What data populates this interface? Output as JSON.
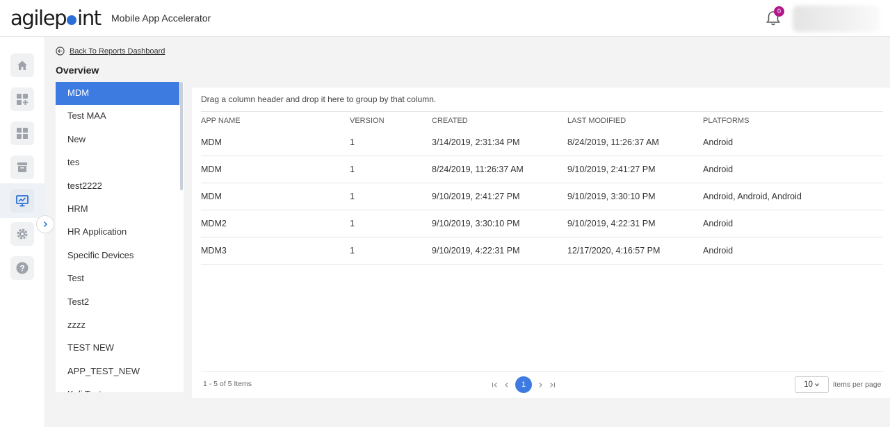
{
  "header": {
    "logo_left": "agilep",
    "logo_right": "int",
    "app_title": "Mobile App Accelerator",
    "notification_count": "0"
  },
  "rail": {
    "items": [
      "home-icon",
      "add-dashboard-icon",
      "dashboard-icon",
      "archive-icon",
      "reports-icon",
      "settings-icon",
      "help-icon"
    ],
    "active": "reports-icon"
  },
  "content": {
    "back_label": "Back To Reports Dashboard",
    "page_title": "Overview"
  },
  "app_list": {
    "items": [
      "MDM",
      "Test MAA",
      "New",
      "tes",
      "test2222",
      "HRM",
      "HR Application",
      "Specific Devices",
      "Test",
      "Test2",
      "zzzz",
      "TEST NEW",
      "APP_TEST_NEW",
      "Kali Test"
    ],
    "selected": "MDM"
  },
  "grid": {
    "group_hint": "Drag a column header and drop it here to group by that column.",
    "columns": [
      "APP NAME",
      "VERSION",
      "CREATED",
      "LAST MODIFIED",
      "PLATFORMS"
    ],
    "rows": [
      [
        "MDM",
        "1",
        "3/14/2019, 2:31:34 PM",
        "8/24/2019, 11:26:37 AM",
        "Android"
      ],
      [
        "MDM",
        "1",
        "8/24/2019, 11:26:37 AM",
        "9/10/2019, 2:41:27 PM",
        "Android"
      ],
      [
        "MDM",
        "1",
        "9/10/2019, 2:41:27 PM",
        "9/10/2019, 3:30:10 PM",
        "Android, Android, Android"
      ],
      [
        "MDM2",
        "1",
        "9/10/2019, 3:30:10 PM",
        "9/10/2019, 4:22:31 PM",
        "Android"
      ],
      [
        "MDM3",
        "1",
        "9/10/2019, 4:22:31 PM",
        "12/17/2020, 4:16:57 PM",
        "Android"
      ]
    ]
  },
  "pager": {
    "info": "1 - 5 of 5 Items",
    "current_page": "1",
    "page_size": "10",
    "page_size_label": "items per page"
  },
  "colors": {
    "accent": "#3d7be0",
    "badge": "#b0178b"
  }
}
